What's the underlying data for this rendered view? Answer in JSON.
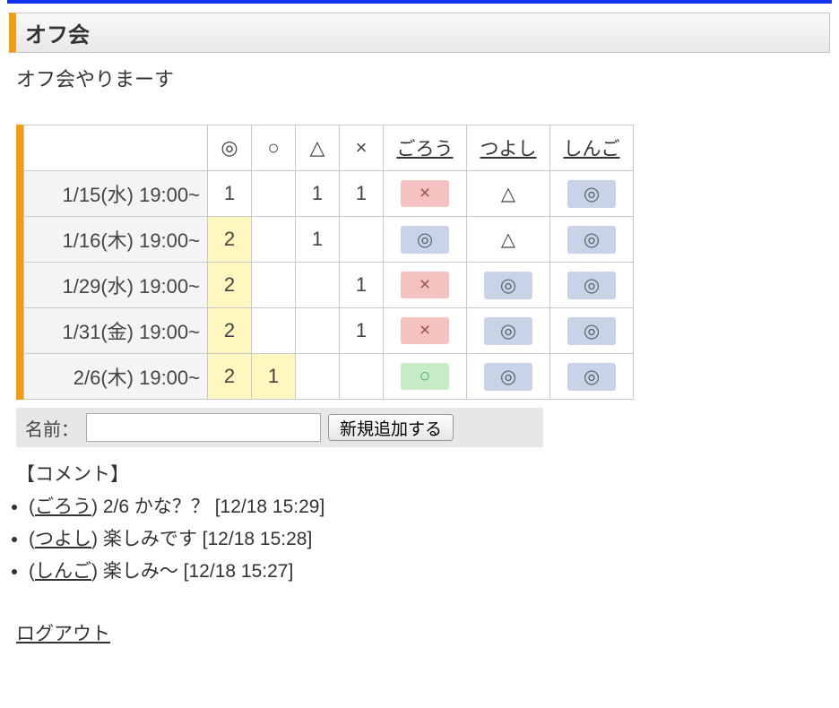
{
  "page": {
    "title": "オフ会",
    "subtitle": "オフ会やりまーす"
  },
  "symbols": {
    "double": "◎",
    "ok": "○",
    "tri": "△",
    "x": "×"
  },
  "users": [
    "ごろう",
    "つよし",
    "しんご"
  ],
  "rows": [
    {
      "label": "1/15(水) 19:00~",
      "counts": {
        "double": "1",
        "ok": "",
        "tri": "1",
        "x": "1"
      },
      "double_best": false,
      "ok_best": false,
      "cells": [
        {
          "sym": "×",
          "style": "x-red"
        },
        {
          "sym": "△",
          "style": "none"
        },
        {
          "sym": "◎",
          "style": "double-blue"
        }
      ]
    },
    {
      "label": "1/16(木) 19:00~",
      "counts": {
        "double": "2",
        "ok": "",
        "tri": "1",
        "x": ""
      },
      "double_best": true,
      "ok_best": false,
      "cells": [
        {
          "sym": "◎",
          "style": "double-blue"
        },
        {
          "sym": "△",
          "style": "none"
        },
        {
          "sym": "◎",
          "style": "double-blue"
        }
      ]
    },
    {
      "label": "1/29(水) 19:00~",
      "counts": {
        "double": "2",
        "ok": "",
        "tri": "",
        "x": "1"
      },
      "double_best": true,
      "ok_best": false,
      "cells": [
        {
          "sym": "×",
          "style": "x-red"
        },
        {
          "sym": "◎",
          "style": "double-blue"
        },
        {
          "sym": "◎",
          "style": "double-blue"
        }
      ]
    },
    {
      "label": "1/31(金) 19:00~",
      "counts": {
        "double": "2",
        "ok": "",
        "tri": "",
        "x": "1"
      },
      "double_best": true,
      "ok_best": false,
      "cells": [
        {
          "sym": "×",
          "style": "x-red"
        },
        {
          "sym": "◎",
          "style": "double-blue"
        },
        {
          "sym": "◎",
          "style": "double-blue"
        }
      ]
    },
    {
      "label": "2/6(木) 19:00~",
      "counts": {
        "double": "2",
        "ok": "1",
        "tri": "",
        "x": ""
      },
      "double_best": true,
      "ok_best": true,
      "cells": [
        {
          "sym": "○",
          "style": "ok-green"
        },
        {
          "sym": "◎",
          "style": "double-blue"
        },
        {
          "sym": "◎",
          "style": "double-blue"
        }
      ]
    }
  ],
  "add": {
    "name_label": "名前：",
    "placeholder": "",
    "button": "新規追加する"
  },
  "comments": {
    "heading": "【コメント】",
    "items": [
      {
        "user": "ごろう",
        "text": "2/6 かな？？",
        "time": "12/18 15:29"
      },
      {
        "user": "つよし",
        "text": "楽しみです",
        "time": "12/18 15:28"
      },
      {
        "user": "しんご",
        "text": "楽しみ〜",
        "time": "12/18 15:27"
      }
    ]
  },
  "logout": "ログアウト"
}
